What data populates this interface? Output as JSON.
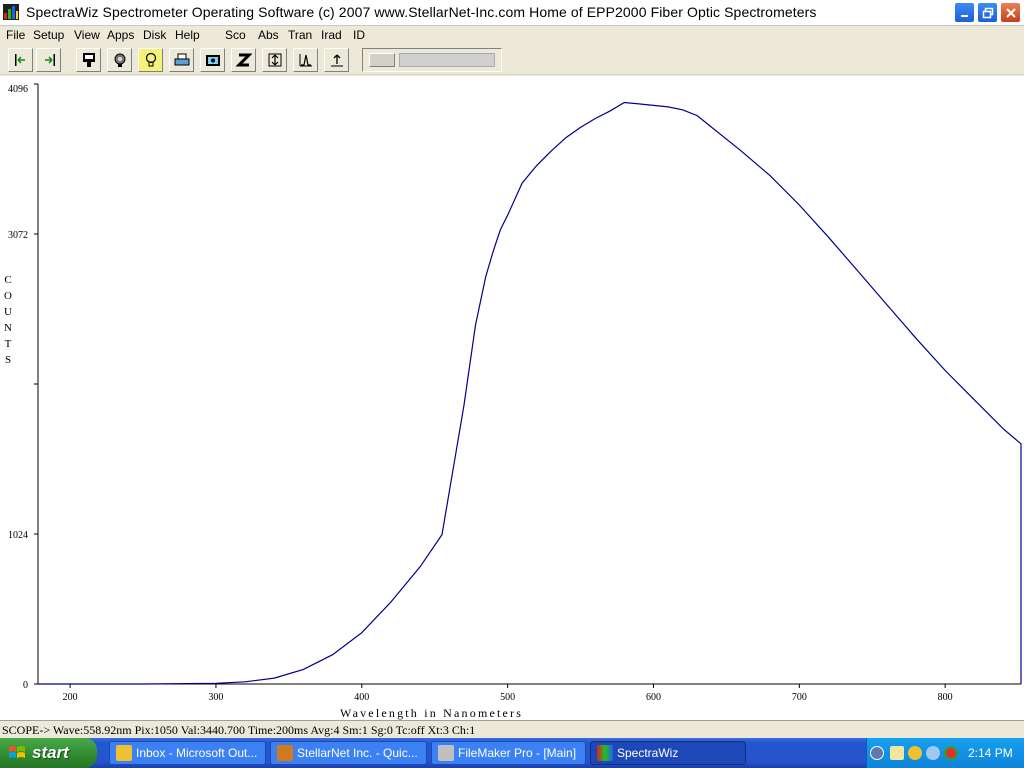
{
  "window": {
    "title": "SpectraWiz  Spectrometer Operating Software (c) 2007  www.StellarNet-Inc.com  Home of EPP2000 Fiber Optic Spectrometers"
  },
  "menu": {
    "items": [
      "File",
      "Setup",
      "View",
      "Apps",
      "Disk",
      "Help",
      "Sco",
      "Abs",
      "Tran",
      "Irad",
      "ID"
    ]
  },
  "toolbar": {
    "buttons": [
      "scroll-left-icon",
      "scroll-right-icon",
      "save-icon",
      "lamp-icon",
      "bulb-icon",
      "print-icon",
      "camera-icon",
      "zoom-icon",
      "autoscale-icon",
      "peak-icon",
      "export-icon"
    ],
    "highlight_color": "#f6f17a"
  },
  "chart_data": {
    "type": "line",
    "title": "",
    "xlabel": "Wavelength in Nanometers",
    "ylabel": "COUNTS",
    "xlim": [
      178,
      852
    ],
    "ylim": [
      0,
      4096
    ],
    "x_ticks": [
      200,
      300,
      400,
      500,
      600,
      700,
      800
    ],
    "y_ticks": [
      0,
      1024,
      3072,
      4096
    ],
    "grid": false,
    "line_color": "#00008b",
    "series": [
      {
        "x": [
          178,
          200,
          250,
          300,
          320,
          340,
          360,
          380,
          400,
          420,
          440,
          455,
          470,
          478,
          485,
          490,
          495,
          500,
          510,
          520,
          530,
          540,
          550,
          560,
          570,
          580,
          590,
          600,
          610,
          620,
          630,
          640,
          660,
          680,
          700,
          720,
          740,
          760,
          780,
          800,
          820,
          840,
          852
        ],
        "y": [
          0,
          0,
          0,
          5,
          15,
          40,
          100,
          200,
          350,
          560,
          800,
          1020,
          1900,
          2450,
          2780,
          2950,
          3100,
          3200,
          3420,
          3540,
          3640,
          3730,
          3800,
          3860,
          3910,
          3970,
          3960,
          3950,
          3940,
          3920,
          3880,
          3800,
          3640,
          3470,
          3270,
          3050,
          2820,
          2590,
          2360,
          2140,
          1940,
          1740,
          1640
        ]
      }
    ]
  },
  "status": {
    "text": "SCOPE->  Wave:558.92nm  Pix:1050  Val:3440.700  Time:200ms  Avg:4  Sm:1  Sg:0  Tc:off  Xt:3  Ch:1"
  },
  "taskbar": {
    "start_label": "start",
    "tasks": [
      {
        "label": "Inbox - Microsoft Out...",
        "icon": "outlook-icon"
      },
      {
        "label": "StellarNet Inc. - Quic...",
        "icon": "browser-icon"
      },
      {
        "label": "FileMaker Pro - [Main]",
        "icon": "filemaker-icon"
      },
      {
        "label": "SpectraWiz",
        "icon": "spectrawiz-icon"
      }
    ],
    "clock": "2:14 PM"
  }
}
